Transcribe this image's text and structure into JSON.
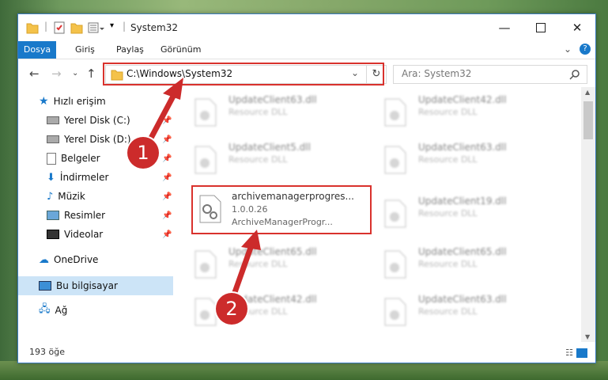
{
  "window": {
    "title": "System32",
    "controls": [
      "minimize-icon",
      "maximize-icon",
      "close-icon"
    ]
  },
  "ribbon": {
    "tabs": [
      "Dosya",
      "Giriş",
      "Paylaş",
      "Görünüm"
    ]
  },
  "address": {
    "path": "C:\\Windows\\System32",
    "search_placeholder": "Ara: System32"
  },
  "sidebar": {
    "quick_access": "Hızlı erişim",
    "items": [
      {
        "label": "Yerel Disk (C:)",
        "icon": "drive-icon"
      },
      {
        "label": "Yerel Disk (D:)",
        "icon": "drive-icon"
      },
      {
        "label": "Belgeler",
        "icon": "documents-icon"
      },
      {
        "label": "İndirmeler",
        "icon": "downloads-icon"
      },
      {
        "label": "Müzik",
        "icon": "music-icon"
      },
      {
        "label": "Resimler",
        "icon": "pictures-icon"
      },
      {
        "label": "Videolar",
        "icon": "videos-icon"
      }
    ],
    "onedrive": "OneDrive",
    "this_pc": "Bu bilgisayar",
    "network": "Ağ"
  },
  "files": [
    {
      "name": "UpdateClient63.dll",
      "desc": "Resource DLL",
      "blurred": true
    },
    {
      "name": "UpdateClient42.dll",
      "desc": "Resource DLL",
      "blurred": true
    },
    {
      "name": "UpdateClient5.dll",
      "desc": "Resource DLL",
      "blurred": true
    },
    {
      "name": "UpdateClient63.dll",
      "desc": "Resource DLL",
      "blurred": true
    },
    {
      "name": "archivemanagerprogres...",
      "version": "1.0.0.26",
      "desc": "ArchiveManagerProgr...",
      "blurred": false
    },
    {
      "name": "UpdateClient19.dll",
      "desc": "Resource DLL",
      "blurred": true
    },
    {
      "name": "UpdateClient65.dll",
      "desc": "Resource DLL",
      "blurred": true
    },
    {
      "name": "UpdateClient65.dll",
      "desc": "Resource DLL",
      "blurred": true
    },
    {
      "name": "UpdateClient42.dll",
      "desc": "Resource DLL",
      "blurred": true
    },
    {
      "name": "UpdateClient63.dll",
      "desc": "Resource DLL",
      "blurred": true
    }
  ],
  "status": {
    "count": "193 öğe"
  },
  "annotations": {
    "step1": "1",
    "step2": "2",
    "color": "#d9322d"
  }
}
